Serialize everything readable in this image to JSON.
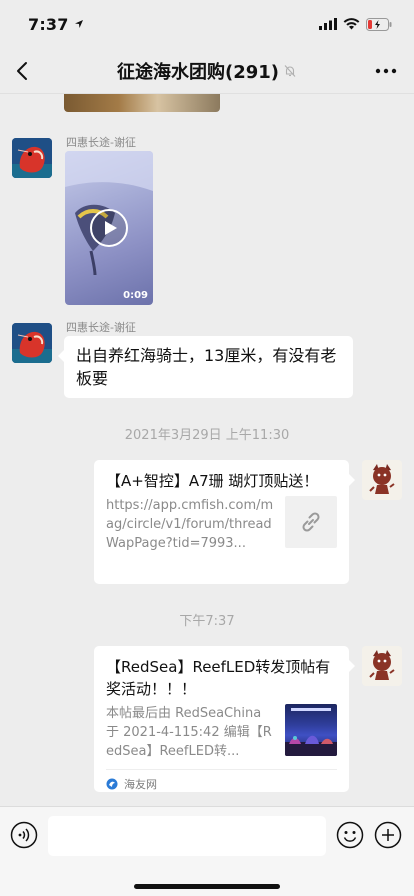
{
  "status": {
    "time": "7:37"
  },
  "nav": {
    "title": "征途海水团购(291)"
  },
  "messages": {
    "sender1": "四惠长途-谢征",
    "video_duration": "0:09",
    "sender2": "四惠长途-谢征",
    "text": "出自养红海骑士，13厘米，有没有老板要",
    "timestamp1": "2021年3月29日 上午11:30",
    "card1": {
      "title": "【A+智控】A7珊 瑚灯顶贴送！",
      "desc": "https://app.cmfish.com/mag/circle/v1/forum/threadWapPage?tid=7993..."
    },
    "timestamp2": "下午7:37",
    "card2": {
      "title": "【RedSea】ReefLED转发顶帖有奖活动！！！",
      "desc": "本帖最后由 RedSeaChina 于 2021-4-115:42 编辑【RedSea】ReefLED转...",
      "source": "海友网"
    }
  },
  "input": {
    "placeholder": ""
  },
  "colors": {
    "background": "#ededed",
    "bubble": "#ffffff",
    "meta_text": "#8a8a8a"
  }
}
